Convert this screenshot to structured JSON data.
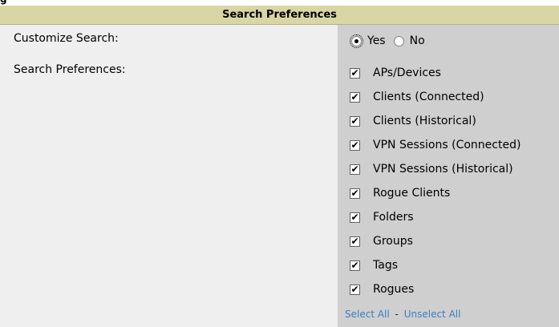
{
  "top_fragment": "g",
  "header": {
    "title": "Search Preferences"
  },
  "form": {
    "customize_label": "Customize Search:",
    "preferences_label": "Search Preferences:",
    "radio_yes": "Yes",
    "radio_no": "No",
    "selected": "Yes",
    "checkboxes": [
      {
        "label": "APs/Devices",
        "checked": true
      },
      {
        "label": "Clients (Connected)",
        "checked": true
      },
      {
        "label": "Clients (Historical)",
        "checked": true
      },
      {
        "label": "VPN Sessions (Connected)",
        "checked": true
      },
      {
        "label": "VPN Sessions (Historical)",
        "checked": true
      },
      {
        "label": "Rogue Clients",
        "checked": true
      },
      {
        "label": "Folders",
        "checked": true
      },
      {
        "label": "Groups",
        "checked": true
      },
      {
        "label": "Tags",
        "checked": true
      },
      {
        "label": "Rogues",
        "checked": true
      }
    ],
    "select_all": "Select All",
    "separator": "-",
    "unselect_all": "Unselect All"
  },
  "colors": {
    "header_bg": "#d9d6a5",
    "left_bg": "#efefef",
    "right_bg": "#cfcfcf",
    "link": "#3a7ebf"
  }
}
